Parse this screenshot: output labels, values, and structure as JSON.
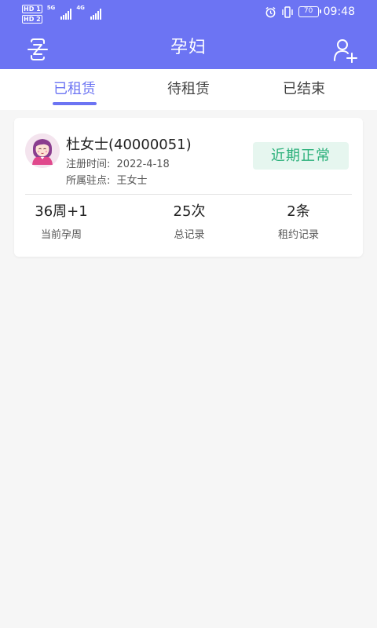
{
  "status_bar": {
    "hd1": "HD 1",
    "hd2": "HD 2",
    "net1": "5G",
    "net2": "4G",
    "battery": "70",
    "time": "09:48"
  },
  "header": {
    "title": "孕妇",
    "left_icon": "scan-icon",
    "right_icon": "add-user-icon",
    "color": "#6c74f3"
  },
  "tabs": [
    {
      "label": "已租赁",
      "active": true
    },
    {
      "label": "待租赁",
      "active": false
    },
    {
      "label": "已结束",
      "active": false
    }
  ],
  "card": {
    "name": "杜女士(40000051)",
    "register_label": "注册时间:",
    "register_value": "2022-4-18",
    "station_label": "所属驻点:",
    "station_value": "王女士",
    "status": "近期正常",
    "status_color": "#2bb07a",
    "stats": [
      {
        "value": "36周+1",
        "label": "当前孕周"
      },
      {
        "value": "25次",
        "label": "总记录"
      },
      {
        "value": "2条",
        "label": "租约记录"
      }
    ]
  }
}
